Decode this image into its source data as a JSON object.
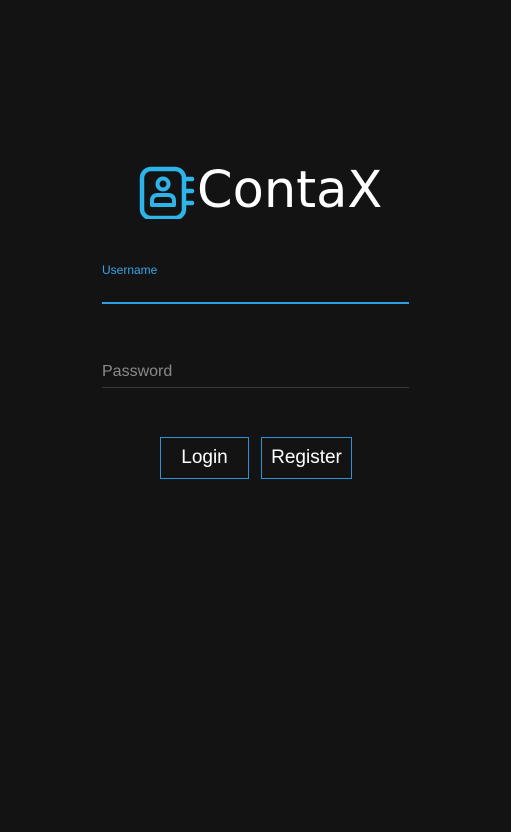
{
  "app": {
    "name": "ContaX",
    "logo_icon": "contact-book-icon",
    "accent_color": "#2d9fe6",
    "background_color": "#131313"
  },
  "login_form": {
    "username": {
      "label": "Username",
      "value": ""
    },
    "password": {
      "placeholder": "Password",
      "value": ""
    },
    "buttons": {
      "login_label": "Login",
      "register_label": "Register"
    }
  }
}
